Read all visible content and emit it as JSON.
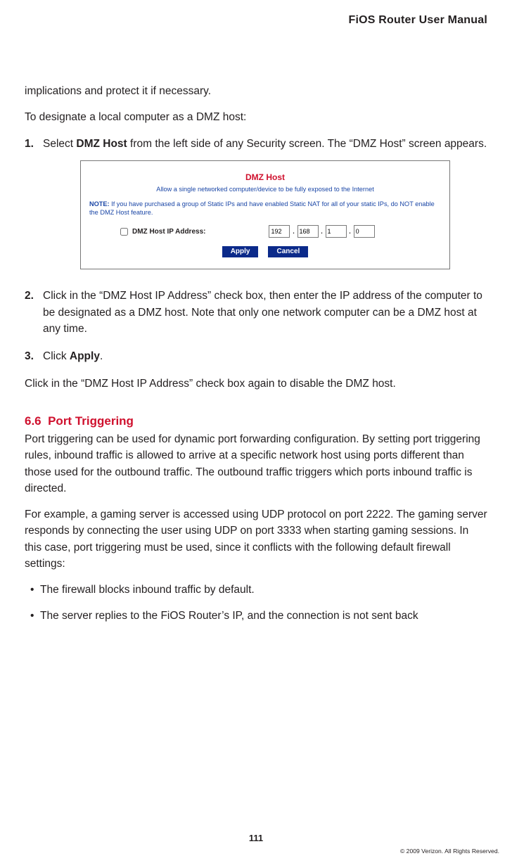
{
  "header": {
    "title": "FiOS Router User Manual"
  },
  "intro": {
    "line1": "implications and protect it if necessary.",
    "line2": "To designate a local computer as a DMZ host:"
  },
  "steps": {
    "s1": {
      "pre": "Select ",
      "bold": "DMZ Host",
      "post": " from the left side of any Security screen. The “DMZ Host” screen appears."
    },
    "s2": "Click in the “DMZ Host IP Address” check box, then enter the IP address of the computer to be designated as a DMZ host. Note that only one network computer can be a DMZ host at any time.",
    "s3": {
      "pre": "Click ",
      "bold": "Apply",
      "post": "."
    }
  },
  "after_steps": "Click in the “DMZ Host IP Address” check box again to disable the DMZ host.",
  "figure": {
    "title": "DMZ Host",
    "subtitle": "Allow a single networked computer/device to be fully exposed to the Internet",
    "note_bold": "NOTE:",
    "note_text": " If you have purchased a group of Static IPs and have enabled Static NAT for all of your static IPs, do NOT enable the DMZ Host feature.",
    "row_label": "DMZ Host IP Address:",
    "ip": [
      "192",
      "168",
      "1",
      "0"
    ],
    "apply": "Apply",
    "cancel": "Cancel"
  },
  "section": {
    "num": "6.6",
    "title": "Port Triggering",
    "p1": "Port triggering can be used for dynamic port forwarding configuration. By setting port triggering rules, inbound traffic is allowed to arrive at a specific network host using ports different than those used for the outbound traffic. The outbound traffic triggers which ports inbound traffic is directed.",
    "p2": "For example, a gaming server is accessed using UDP protocol on port 2222. The gaming server responds by connecting the user using UDP on port 3333 when starting gaming sessions. In this case, port triggering must be used, since it conflicts with the following default firewall settings:",
    "bullets": [
      "The firewall blocks inbound traffic by default.",
      "The server replies to the FiOS Router’s IP, and the connection is not sent back"
    ]
  },
  "footer": {
    "page": "111",
    "copyright": "© 2009 Verizon. All Rights Reserved."
  }
}
